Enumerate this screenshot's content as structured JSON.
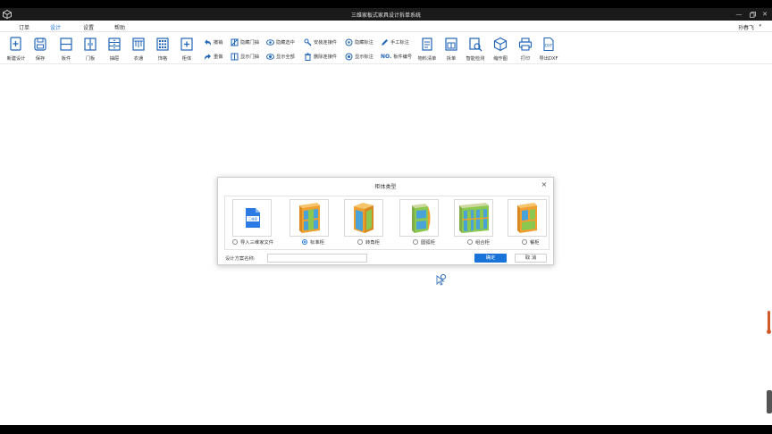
{
  "window": {
    "title": "三维家板式家具设计拆单系统",
    "controls": [
      "minimize-icon",
      "restore-icon",
      "close-icon"
    ]
  },
  "menu": {
    "tabs": [
      {
        "label": "订单",
        "active": false
      },
      {
        "label": "设计",
        "active": true
      },
      {
        "label": "设置",
        "active": false
      },
      {
        "label": "帮助",
        "active": false
      }
    ],
    "user": "孙春飞"
  },
  "toolbar": {
    "big": [
      {
        "label": "新建设计",
        "icon": "new-design-icon"
      },
      {
        "label": "保存",
        "icon": "save-icon"
      },
      {
        "label": "板件",
        "icon": "panel-icon"
      },
      {
        "label": "门板",
        "icon": "door-panel-icon"
      },
      {
        "label": "抽屉",
        "icon": "drawer-icon"
      },
      {
        "label": "衣通",
        "icon": "hanging-rod-icon"
      },
      {
        "label": "饰格",
        "icon": "grid-icon"
      },
      {
        "label": "柜体",
        "icon": "cabinet-icon"
      }
    ],
    "small": [
      {
        "label": "撤销",
        "icon": "undo-icon"
      },
      {
        "label": "重做",
        "icon": "redo-icon"
      },
      {
        "label": "隐藏门抽",
        "icon": "hide-doors-icon"
      },
      {
        "label": "显示门抽",
        "icon": "show-doors-icon"
      },
      {
        "label": "隐藏选中",
        "icon": "hide-selected-icon"
      },
      {
        "label": "显示全部",
        "icon": "show-all-icon"
      },
      {
        "label": "安装连接件",
        "icon": "install-connector-icon"
      },
      {
        "label": "删除连接件",
        "icon": "delete-connector-icon"
      },
      {
        "label": "隐藏标注",
        "icon": "hide-dimensions-icon"
      },
      {
        "label": "显示标注",
        "icon": "show-dimensions-icon"
      },
      {
        "label": "手工标注",
        "icon": "manual-dimension-icon"
      },
      {
        "label": "板件编号",
        "icon": "panel-number-icon"
      }
    ],
    "big2": [
      {
        "label": "物料清单",
        "icon": "material-list-icon"
      },
      {
        "label": "拆单",
        "icon": "split-order-icon"
      },
      {
        "label": "智能检测",
        "icon": "smart-check-icon"
      },
      {
        "label": "缩作图",
        "icon": "3d-view-icon"
      },
      {
        "label": "打印",
        "icon": "print-icon"
      },
      {
        "label": "导出DXF",
        "icon": "export-dxf-icon"
      }
    ],
    "dxf_badge": "DXF",
    "number_badge": "NO."
  },
  "dialog": {
    "title": "柜体类型",
    "file_badge": "三维家",
    "options": [
      {
        "label": "导入三维家文件",
        "checked": false
      },
      {
        "label": "标准柜",
        "checked": true
      },
      {
        "label": "转角柜",
        "checked": false
      },
      {
        "label": "圆弧柜",
        "checked": false
      },
      {
        "label": "组合柜",
        "checked": false
      },
      {
        "label": "餐柜",
        "checked": false
      }
    ],
    "name_label": "设计方案名称:",
    "name_value": "",
    "ok_label": "确定",
    "cancel_label": "取 消"
  },
  "colors": {
    "accent": "#1a73d9",
    "cabinet_orange": "#f0a030",
    "cabinet_green": "#8cc850",
    "cabinet_blue": "#4aa3d8"
  }
}
